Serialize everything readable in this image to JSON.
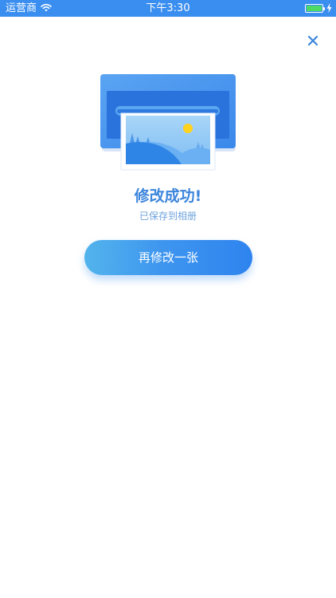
{
  "status_bar": {
    "carrier": "运营商",
    "time": "下午3:30",
    "battery_level": 1.0,
    "background": "#3a8ef0"
  },
  "close": {
    "icon": "close-icon",
    "color": "#3d86dc"
  },
  "result": {
    "title": "修改成功!",
    "subtitle": "已保存到相册"
  },
  "actions": {
    "again_label": "再修改一张"
  }
}
